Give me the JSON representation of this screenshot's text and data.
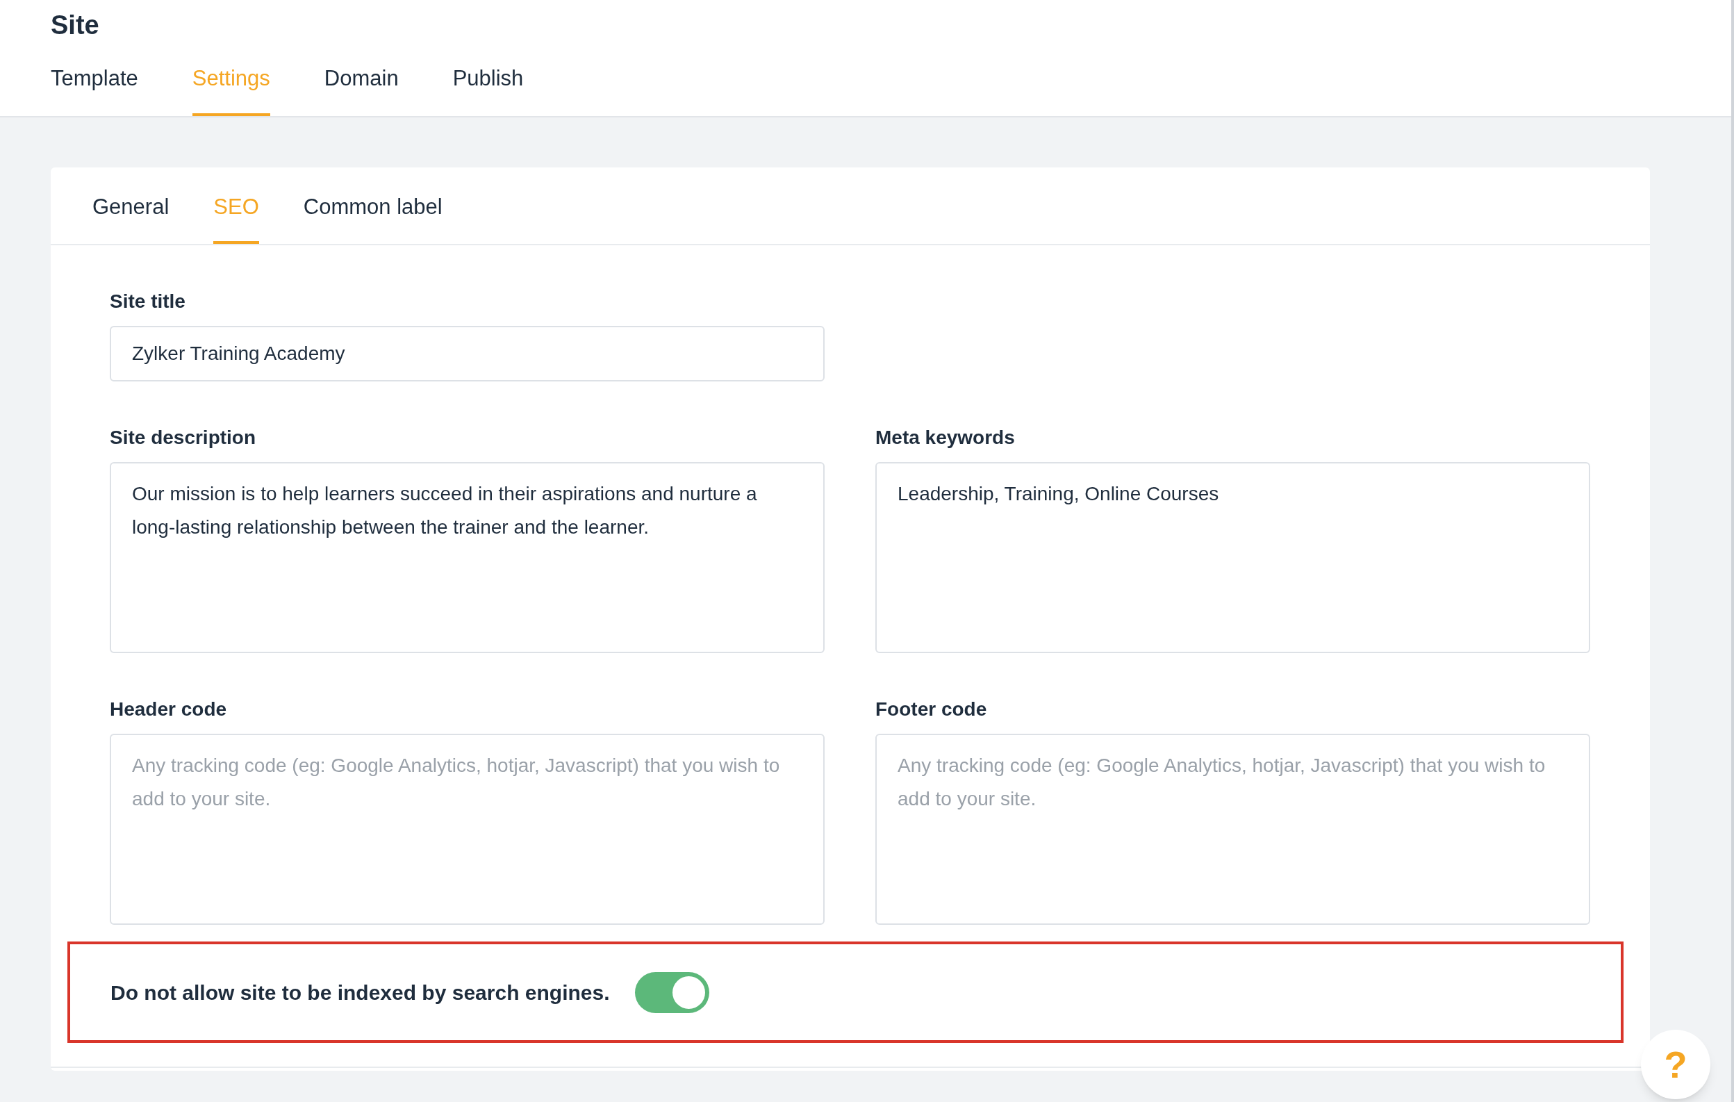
{
  "page_title": "Site",
  "tabs": [
    {
      "label": "Template",
      "selected": false
    },
    {
      "label": "Settings",
      "selected": true
    },
    {
      "label": "Domain",
      "selected": false
    },
    {
      "label": "Publish",
      "selected": false
    }
  ],
  "subtabs": [
    {
      "label": "General",
      "selected": false
    },
    {
      "label": "SEO",
      "selected": true
    },
    {
      "label": "Common label",
      "selected": false
    }
  ],
  "field_rows": [
    [
      {
        "kind": "input",
        "label": "Site title",
        "value": "Zylker Training Academy"
      }
    ],
    [
      {
        "kind": "textarea",
        "label": "Site description",
        "value": "Our mission is to help learners succeed in their aspirations and nurture a long-lasting relationship between the trainer and the learner."
      },
      {
        "kind": "textarea",
        "label": "Meta keywords",
        "value": "Leadership, Training, Online Courses"
      }
    ],
    [
      {
        "kind": "textarea",
        "label": "Header code",
        "placeholder": "Any tracking code (eg: Google Analytics, hotjar, Javascript) that you wish to add to your site."
      },
      {
        "kind": "textarea",
        "label": "Footer code",
        "placeholder": "Any tracking code (eg: Google Analytics, hotjar, Javascript) that you wish to add to your site."
      }
    ]
  ],
  "index_toggle": {
    "label": "Do not allow site to be indexed by search engines.",
    "on": true
  },
  "help_button": "?"
}
